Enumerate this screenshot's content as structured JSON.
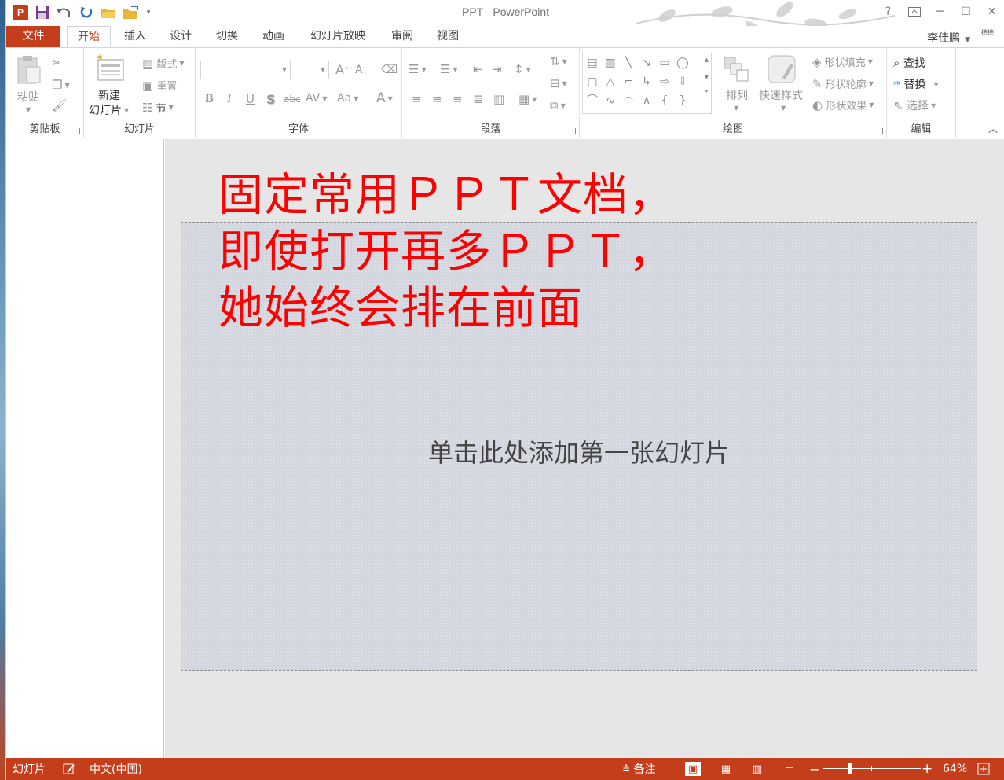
{
  "window": {
    "title": "PPT - PowerPoint"
  },
  "qat": {
    "icons": [
      "powerpoint-logo-icon",
      "save-icon",
      "undo-icon",
      "redo-icon",
      "open-icon",
      "folder-icon",
      "customize-icon"
    ],
    "logo_text": "P"
  },
  "title_controls": {
    "help": "?",
    "restore_ribbon": "⬆",
    "minimize": "─",
    "maximize": "☐",
    "close": "✕"
  },
  "tabs": [
    "文件",
    "开始",
    "插入",
    "设计",
    "切换",
    "动画",
    "幻灯片放映",
    "审阅",
    "视图"
  ],
  "user": {
    "name": "李佳鹏",
    "avatar_text": "德德"
  },
  "ribbon": {
    "clipboard": {
      "label": "剪贴板",
      "paste": "粘贴"
    },
    "slides": {
      "label": "幻灯片",
      "new_slide_line1": "新建",
      "new_slide_line2": "幻灯片",
      "layout": "版式",
      "reset": "重置",
      "section": "节"
    },
    "font": {
      "label": "字体",
      "bold": "B",
      "italic": "I",
      "underline": "U",
      "shadow": "S",
      "strike": "abc",
      "spacing": "AV",
      "case": "Aa",
      "color": "A",
      "grow": "A",
      "shrink": "A"
    },
    "paragraph": {
      "label": "段落"
    },
    "drawing": {
      "label": "绘图",
      "arrange": "排列",
      "quick_styles": "快速样式",
      "fill": "形状填充",
      "outline": "形状轮廓",
      "effects": "形状效果"
    },
    "editing": {
      "label": "编辑",
      "find": "查找",
      "replace": "替换",
      "select": "选择"
    }
  },
  "slide": {
    "placeholder": "单击此处添加第一张幻灯片"
  },
  "annotation": {
    "line1": "固定常用ＰＰＴ文档，",
    "line2": "即使打开再多ＰＰＴ，",
    "line3": "她始终会排在前面"
  },
  "status": {
    "slide_label": "幻灯片",
    "language": "中文(中国)",
    "notes": "备注",
    "zoom_level": "64%",
    "zoom_minus": "−",
    "zoom_plus": "+"
  },
  "colors": {
    "accent": "#c43e1c",
    "annotation": "#ff0000",
    "slide_bg": "#d3d6de"
  }
}
